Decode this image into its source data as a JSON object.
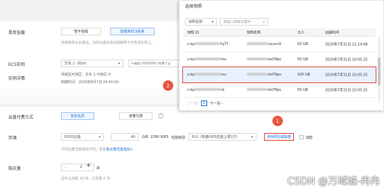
{
  "form": {
    "cloud_disk": {
      "label": "是否挂载",
      "btn_none": "暂不挂载",
      "btn_ecs": "挂载到ECS实例",
      "hint": "挂载到单台云盘后，当前云盘会自动挂载到下方所选实例上。"
    },
    "ecs_instance": {
      "label": "ECS实例",
      "region": "华东 1（杭州）",
      "instance_prefix": "i-bp1",
      "instance_suffix": "m3f / y"
    },
    "instance_detail": {
      "label": "实例详情",
      "line1": "地域及可用区：华东 1 可用区 H",
      "line2": "到期时间：2020年8月7日 24:00:00"
    },
    "billing": {
      "label": "云盘付费方式",
      "btn_subscription": "包年包月",
      "btn_payg": "按量付费"
    },
    "storage": {
      "label": "存储",
      "disk_type": "ESSD云盘",
      "size": "40",
      "unit": "GiB",
      "iops": "2280 IOPS",
      "perf_label": "性能级别",
      "perf_level": "PL0（单盘IOPS性能上限1万）",
      "snapshot_link": "用快照创建磁盘",
      "encrypt": "加密",
      "hint_prefix": "不同云盘性能指标不同，查看",
      "hint_link": "各云盘性能指标>"
    },
    "quantity": {
      "label": "购买量",
      "value": "1",
      "minus": "–",
      "plus": "+",
      "unit": "块",
      "hint": "还可以挂载 16 块，已挂载 0 块"
    }
  },
  "modal": {
    "title": "选择快照",
    "filter_select": "快照名称",
    "search_placeholder": "请输入搜索关键字",
    "columns": [
      "快照 ID",
      "快照名称",
      "大小",
      "创建时间"
    ],
    "rows": [
      {
        "id_prefix": "s-bp",
        "id_suffix": "7q77",
        "name": "ecsnc9",
        "size": "50 GB",
        "created": "2020年7月31日 11:14:08",
        "highlighted": false
      },
      {
        "id_prefix": "s-bp",
        "id_suffix": "mv",
        "name": "old78ps",
        "size": "50 GB",
        "created": "2020年7月31日 10:05:25",
        "highlighted": false
      },
      {
        "id_prefix": "s-bp",
        "id_suffix": "mv",
        "name": "old78ps",
        "size": "100 GB",
        "created": "2020年7月31日 10:05:25",
        "highlighted": true
      },
      {
        "id_prefix": "s-bp",
        "id_suffix": "nt",
        "name": "old78ps",
        "size": "50 GB",
        "created": "2020年7月31日 10:05:25",
        "highlighted": false
      }
    ],
    "pager": {
      "prev": "上一页",
      "next": "下一页",
      "current": "1"
    }
  },
  "badges": {
    "step1": "1",
    "step2": "2"
  },
  "watermark": "CSDN @万域城-冉冉",
  "colors": {
    "accent": "#1e6fd9",
    "highlight_border": "#e0463a",
    "badge": "#e8553f"
  }
}
